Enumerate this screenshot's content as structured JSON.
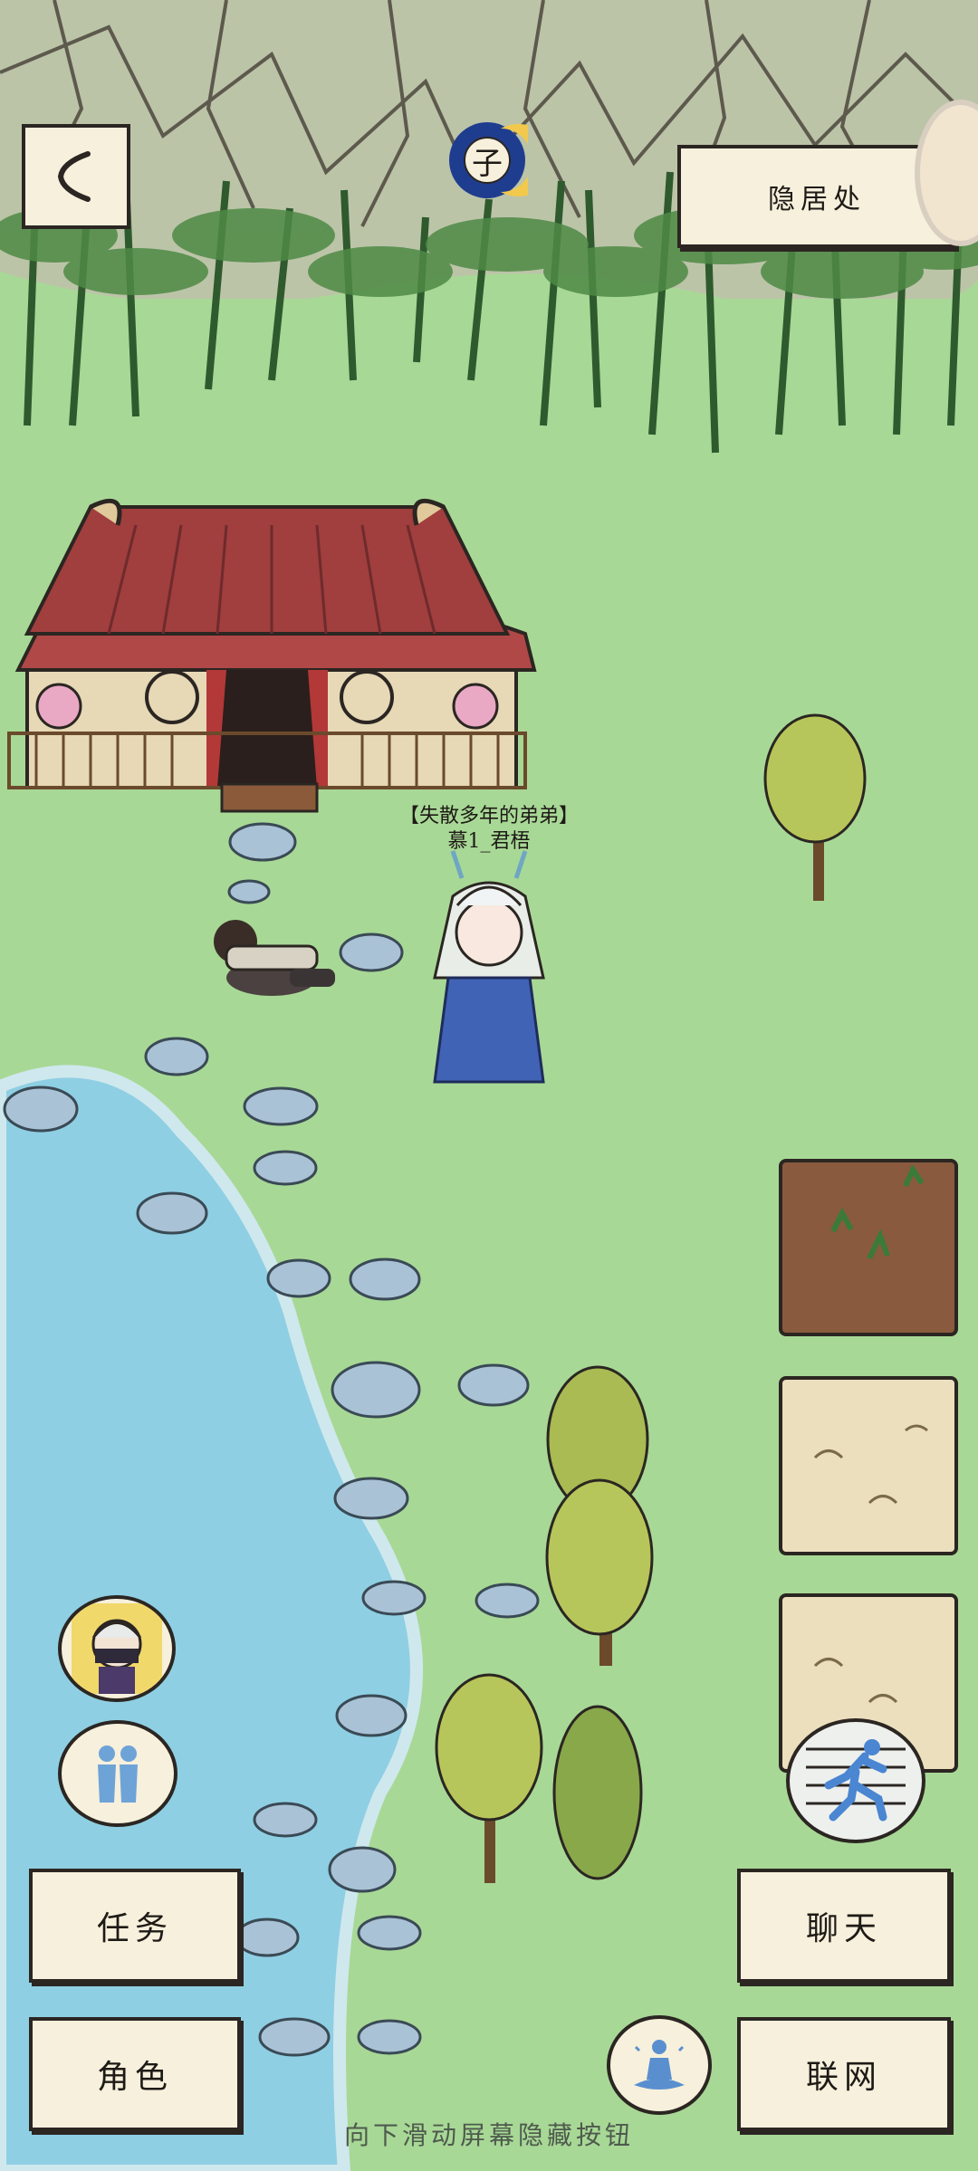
{
  "location": {
    "name": "隐居处"
  },
  "time_badge": {
    "char": "子"
  },
  "npc": {
    "title": "【失散多年的弟弟】",
    "name": "慕1_君梧"
  },
  "buttons": {
    "task": "任务",
    "role": "角色",
    "chat": "聊天",
    "network": "联网"
  },
  "hint": "向下滑动屏幕隐藏按钮",
  "icons": {
    "back": "back-arrow-icon",
    "time": "moon-time-icon",
    "companion": "ninja-avatar-icon",
    "party": "two-people-icon",
    "run": "running-figure-icon",
    "meditate": "meditation-icon"
  }
}
